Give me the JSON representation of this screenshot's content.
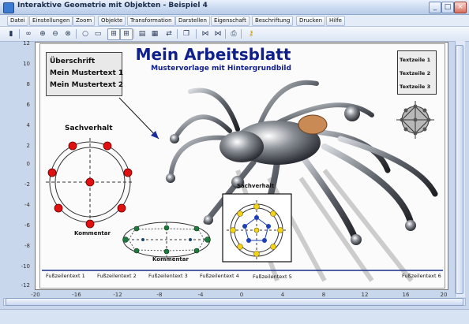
{
  "window": {
    "title": "Interaktive Geometrie mit Objekten - Beispiel 4",
    "minimize_glyph": "_",
    "maximize_glyph": "□",
    "close_glyph": "×"
  },
  "menu": [
    "Datei",
    "Einstellungen",
    "Zoom",
    "Objekte",
    "Transformation",
    "Darstellen",
    "Eigenschaft",
    "Beschriftung",
    "Drucken",
    "Hilfe"
  ],
  "toolbar": {
    "icons": [
      "printer-icon",
      "binoculars-icon",
      "zoom-in-icon",
      "zoom-out-icon",
      "zoom-fit-icon",
      "circle-tool-icon",
      "frame-tool-icon",
      "grid-a-icon",
      "grid-b-icon",
      "table-icon",
      "calculator-icon",
      "transfer-icon",
      "page-icon",
      "node-a-icon",
      "node-b-icon",
      "print-icon",
      "help-key-icon"
    ]
  },
  "worksheet": {
    "title": "Mein Arbeitsblatt",
    "subtitle": "Mustervorlage mit Hintergrundbild",
    "textbox": [
      "Überschrift",
      "Mein Mustertext 1",
      "Mein Mustertext 2"
    ],
    "linesbox": [
      "Textzeile 1",
      "Textzeile 2",
      "Textzeile 3"
    ],
    "label_sachverhalt_left": "Sachverhalt",
    "label_sachverhalt_right": "Sachverhalt",
    "label_kommentar_1": "Kommentar",
    "label_kommentar_2": "Kommentar",
    "footer": [
      "Fußzeilentext 1",
      "Fußzeilentext 2",
      "Fußzeilentext 3",
      "Fußzeilentext 4",
      "Fußzeilentext 5",
      "Fußzeilentext 6"
    ]
  },
  "axes": {
    "y_ticks": [
      "12",
      "10",
      "8",
      "6",
      "4",
      "2",
      "0",
      "-2",
      "-4",
      "-6",
      "-8",
      "-10",
      "-12"
    ],
    "x_ticks": [
      "-20",
      "-16",
      "-12",
      "-8",
      "-4",
      "0",
      "4",
      "8",
      "12",
      "16",
      "20"
    ]
  },
  "colors": {
    "title_blue": "#10208a",
    "red_point": "#e01010",
    "green_point": "#1d7a3a",
    "yellow_point": "#f2d21a",
    "blue_point": "#1d3fb8"
  }
}
